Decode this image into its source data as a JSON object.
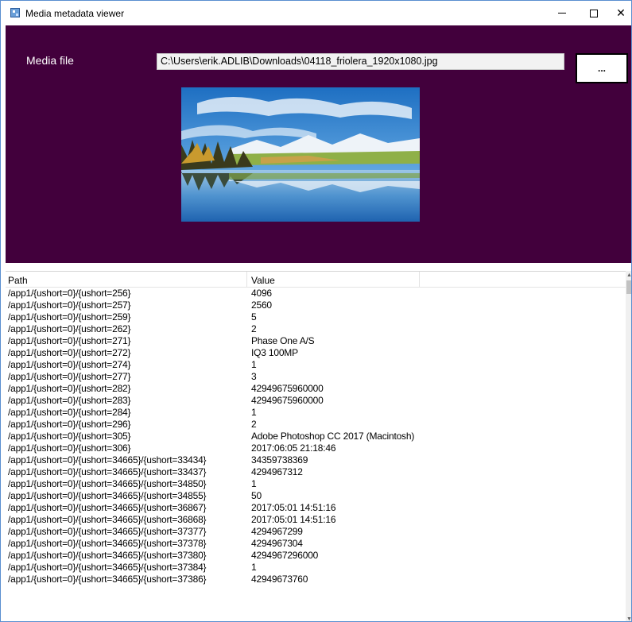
{
  "window": {
    "title": "Media metadata viewer",
    "controls": {
      "minimize": "minimize-icon",
      "maximize": "maximize-icon",
      "close": "✕"
    }
  },
  "form": {
    "media_label": "Media file",
    "path_value": "C:\\Users\\erik.ADLIB\\Downloads\\04118_friolera_1920x1080.jpg",
    "browse_label": "...",
    "panel_color": "#42003c"
  },
  "preview": {
    "icon": "landscape-image"
  },
  "table": {
    "headers": {
      "path": "Path",
      "value": "Value"
    },
    "rows": [
      {
        "path": "/app1/{ushort=0}/{ushort=256}",
        "value": "4096"
      },
      {
        "path": "/app1/{ushort=0}/{ushort=257}",
        "value": "2560"
      },
      {
        "path": "/app1/{ushort=0}/{ushort=259}",
        "value": "5"
      },
      {
        "path": "/app1/{ushort=0}/{ushort=262}",
        "value": "2"
      },
      {
        "path": "/app1/{ushort=0}/{ushort=271}",
        "value": "Phase One A/S"
      },
      {
        "path": "/app1/{ushort=0}/{ushort=272}",
        "value": "IQ3 100MP"
      },
      {
        "path": "/app1/{ushort=0}/{ushort=274}",
        "value": "1"
      },
      {
        "path": "/app1/{ushort=0}/{ushort=277}",
        "value": "3"
      },
      {
        "path": "/app1/{ushort=0}/{ushort=282}",
        "value": "42949675960000"
      },
      {
        "path": "/app1/{ushort=0}/{ushort=283}",
        "value": "42949675960000"
      },
      {
        "path": "/app1/{ushort=0}/{ushort=284}",
        "value": "1"
      },
      {
        "path": "/app1/{ushort=0}/{ushort=296}",
        "value": "2"
      },
      {
        "path": "/app1/{ushort=0}/{ushort=305}",
        "value": "Adobe Photoshop CC 2017 (Macintosh)"
      },
      {
        "path": "/app1/{ushort=0}/{ushort=306}",
        "value": "2017:06:05 21:18:46"
      },
      {
        "path": "/app1/{ushort=0}/{ushort=34665}/{ushort=33434}",
        "value": "34359738369"
      },
      {
        "path": "/app1/{ushort=0}/{ushort=34665}/{ushort=33437}",
        "value": "4294967312"
      },
      {
        "path": "/app1/{ushort=0}/{ushort=34665}/{ushort=34850}",
        "value": "1"
      },
      {
        "path": "/app1/{ushort=0}/{ushort=34665}/{ushort=34855}",
        "value": "50"
      },
      {
        "path": "/app1/{ushort=0}/{ushort=34665}/{ushort=36867}",
        "value": "2017:05:01 14:51:16"
      },
      {
        "path": "/app1/{ushort=0}/{ushort=34665}/{ushort=36868}",
        "value": "2017:05:01 14:51:16"
      },
      {
        "path": "/app1/{ushort=0}/{ushort=34665}/{ushort=37377}",
        "value": "4294967299"
      },
      {
        "path": "/app1/{ushort=0}/{ushort=34665}/{ushort=37378}",
        "value": "4294967304"
      },
      {
        "path": "/app1/{ushort=0}/{ushort=34665}/{ushort=37380}",
        "value": "4294967296000"
      },
      {
        "path": "/app1/{ushort=0}/{ushort=34665}/{ushort=37384}",
        "value": "1"
      },
      {
        "path": "/app1/{ushort=0}/{ushort=34665}/{ushort=37386}",
        "value": "42949673760"
      }
    ]
  },
  "scrollbar": {
    "up": "▲",
    "down": "▼"
  }
}
